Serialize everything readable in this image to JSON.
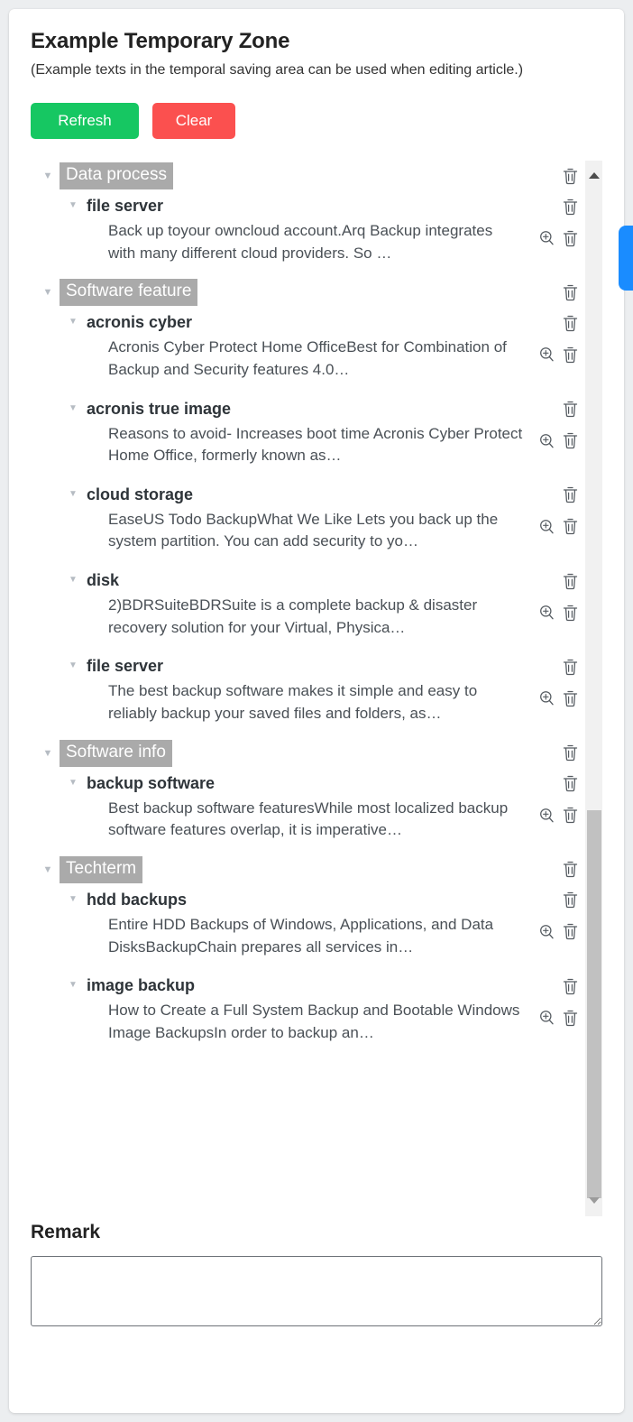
{
  "page": {
    "title": "Example Temporary Zone",
    "subtitle": "(Example texts in the temporal saving area can be used when editing article.)"
  },
  "buttons": {
    "refresh_label": "Refresh",
    "clear_label": "Clear",
    "refresh_color": "#16c762",
    "clear_color": "#fb504f"
  },
  "icons": {
    "delete": "trash-icon",
    "zoom": "magnifier-plus-icon",
    "caret": "caret-down-icon",
    "scroll_up": "triangle-up-icon",
    "scroll_down": "triangle-down-icon",
    "edge_tab": "side-panel-toggle"
  },
  "tree": {
    "caret_glyph": "▼",
    "categories": [
      {
        "label": "Data process",
        "keywords": [
          {
            "label": "file server",
            "snippet": "Back up toyour owncloud account.Arq Backup integrates with many different cloud providers. So …"
          }
        ]
      },
      {
        "label": "Software feature",
        "keywords": [
          {
            "label": "acronis cyber",
            "snippet": "Acronis Cyber Protect Home OfficeBest for Combination of Backup and Security features 4.0…"
          },
          {
            "label": "acronis true image",
            "snippet": "Reasons to avoid- Increases boot time Acronis Cyber Protect Home Office, formerly known as…"
          },
          {
            "label": "cloud storage",
            "snippet": "EaseUS Todo BackupWhat We Like Lets you back up the system partition. You can add security to yo…"
          },
          {
            "label": "disk",
            "snippet": "2)BDRSuiteBDRSuite is a complete backup & disaster recovery solution for your Virtual, Physica…"
          },
          {
            "label": "file server",
            "snippet": "The best backup software makes it simple and easy to reliably backup your saved files and folders, as…"
          }
        ]
      },
      {
        "label": "Software info",
        "keywords": [
          {
            "label": "backup software",
            "snippet": "Best backup software featuresWhile most localized backup software features overlap, it is imperative…"
          }
        ]
      },
      {
        "label": "Techterm",
        "keywords": [
          {
            "label": "hdd backups",
            "snippet": "Entire HDD Backups of Windows, Applications, and Data DisksBackupChain prepares all services in…"
          },
          {
            "label": "image backup",
            "snippet": "How to Create a Full System Backup and Bootable Windows Image BackupsIn order to backup an…"
          }
        ]
      }
    ]
  },
  "remark": {
    "title": "Remark",
    "value": "",
    "placeholder": ""
  }
}
